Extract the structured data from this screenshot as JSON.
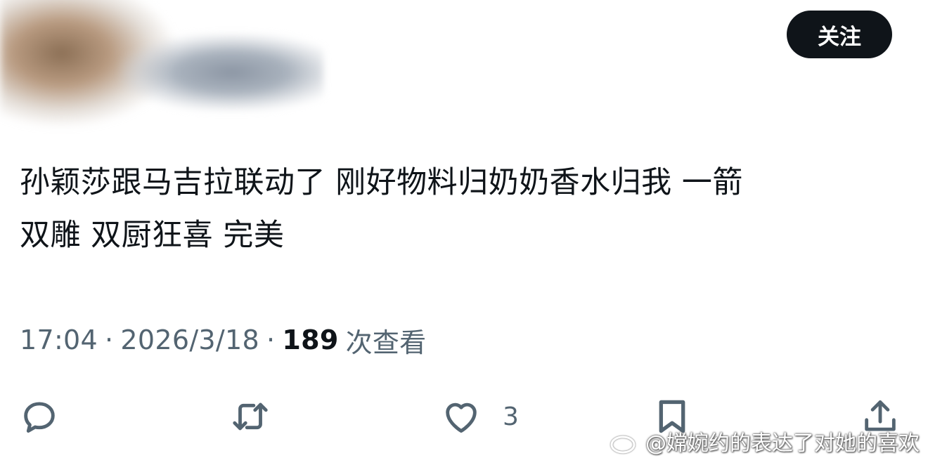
{
  "header": {
    "follow_label": "关注"
  },
  "tweet": {
    "text": "孙颖莎跟马吉拉联动了 刚好物料归奶奶香水归我 一箭\n双雕 双厨狂喜 完美",
    "time": "17:04",
    "date": "2026/3/18",
    "separator": "·",
    "views_count": "189",
    "views_label": "次查看"
  },
  "actions": {
    "reply_icon": "reply-icon",
    "retweet_icon": "retweet-icon",
    "like_icon": "heart-icon",
    "like_count": "3",
    "bookmark_icon": "bookmark-icon",
    "share_icon": "share-icon"
  },
  "watermark": {
    "text": "@嫦婉约的表达了对她的喜欢"
  },
  "colors": {
    "text": "#0f1419",
    "secondary": "#536471",
    "button_bg": "#0f1419",
    "button_text": "#ffffff",
    "background": "#ffffff"
  }
}
